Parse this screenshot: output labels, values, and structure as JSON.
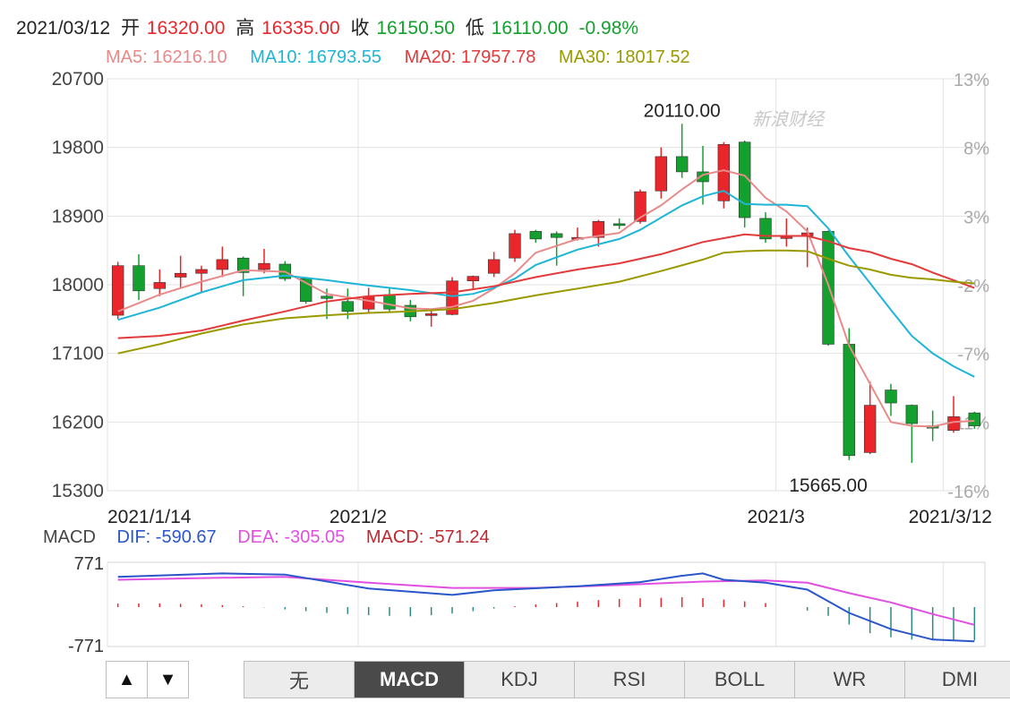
{
  "header": {
    "date": "2021/03/12",
    "open_label": "开",
    "open": "16320.00",
    "high_label": "高",
    "high": "16335.00",
    "close_label": "收",
    "close": "16150.50",
    "low_label": "低",
    "low": "16110.00",
    "change": "-0.98%"
  },
  "ma_legend": [
    {
      "label": "MA5: 16216.10",
      "color": "#e88a8a"
    },
    {
      "label": "MA10: 16793.55",
      "color": "#1fb5d6"
    },
    {
      "label": "MA20: 17957.78",
      "color": "#e23a3a"
    },
    {
      "label": "MA30: 18017.52",
      "color": "#9a9a00"
    }
  ],
  "watermark": "新浪财经",
  "colors": {
    "up": "#e8262b",
    "down": "#14a02e",
    "grid": "#e3e3e3"
  },
  "chart_data": {
    "type": "candlestick",
    "ylim": [
      15300,
      20700
    ],
    "y_ticks": [
      "20700",
      "19800",
      "18900",
      "18000",
      "17100",
      "16200",
      "15300"
    ],
    "pct_ticks": [
      "13%",
      "8%",
      "3%",
      "-2%",
      "-7%",
      "-11%",
      "-16%"
    ],
    "x_labels": [
      {
        "label": "2021/1/14",
        "index": 0
      },
      {
        "label": "2021/2",
        "index": 12
      },
      {
        "label": "2021/3",
        "index": 32
      },
      {
        "label": "2021/3/12",
        "index": 40
      }
    ],
    "annotations": [
      {
        "text": "20110.00",
        "index": 27,
        "value": 20110
      },
      {
        "text": "15665.00",
        "index": 34,
        "value": 15665
      }
    ],
    "candles": [
      {
        "o": 17600,
        "h": 18300,
        "l": 17550,
        "c": 18250
      },
      {
        "o": 18250,
        "h": 18400,
        "l": 17800,
        "c": 17920
      },
      {
        "o": 17950,
        "h": 18200,
        "l": 17850,
        "c": 18030
      },
      {
        "o": 18100,
        "h": 18380,
        "l": 17950,
        "c": 18150
      },
      {
        "o": 18150,
        "h": 18250,
        "l": 17900,
        "c": 18200
      },
      {
        "o": 18200,
        "h": 18500,
        "l": 18100,
        "c": 18330
      },
      {
        "o": 18350,
        "h": 18370,
        "l": 17850,
        "c": 18160
      },
      {
        "o": 18200,
        "h": 18470,
        "l": 18150,
        "c": 18280
      },
      {
        "o": 18270,
        "h": 18310,
        "l": 18050,
        "c": 18080
      },
      {
        "o": 18080,
        "h": 18100,
        "l": 17750,
        "c": 17780
      },
      {
        "o": 17850,
        "h": 17950,
        "l": 17550,
        "c": 17820
      },
      {
        "o": 17780,
        "h": 17950,
        "l": 17550,
        "c": 17650
      },
      {
        "o": 17680,
        "h": 17960,
        "l": 17620,
        "c": 17850
      },
      {
        "o": 17870,
        "h": 17950,
        "l": 17650,
        "c": 17680
      },
      {
        "o": 17730,
        "h": 17800,
        "l": 17520,
        "c": 17580
      },
      {
        "o": 17620,
        "h": 17680,
        "l": 17450,
        "c": 17620
      },
      {
        "o": 17610,
        "h": 18100,
        "l": 17600,
        "c": 18050
      },
      {
        "o": 18050,
        "h": 18120,
        "l": 17950,
        "c": 18110
      },
      {
        "o": 18150,
        "h": 18430,
        "l": 18100,
        "c": 18330
      },
      {
        "o": 18350,
        "h": 18720,
        "l": 18300,
        "c": 18670
      },
      {
        "o": 18700,
        "h": 18720,
        "l": 18550,
        "c": 18600
      },
      {
        "o": 18670,
        "h": 18700,
        "l": 18250,
        "c": 18620
      },
      {
        "o": 18610,
        "h": 18750,
        "l": 18580,
        "c": 18620
      },
      {
        "o": 18620,
        "h": 18850,
        "l": 18500,
        "c": 18830
      },
      {
        "o": 18800,
        "h": 18870,
        "l": 18730,
        "c": 18780
      },
      {
        "o": 18830,
        "h": 19250,
        "l": 18800,
        "c": 19220
      },
      {
        "o": 19230,
        "h": 19800,
        "l": 19130,
        "c": 19680
      },
      {
        "o": 19680,
        "h": 20110,
        "l": 19400,
        "c": 19480
      },
      {
        "o": 19480,
        "h": 19820,
        "l": 19050,
        "c": 19350
      },
      {
        "o": 19100,
        "h": 19870,
        "l": 19000,
        "c": 19840
      },
      {
        "o": 19870,
        "h": 19890,
        "l": 18750,
        "c": 18880
      },
      {
        "o": 18870,
        "h": 18950,
        "l": 18550,
        "c": 18600
      },
      {
        "o": 18610,
        "h": 18870,
        "l": 18500,
        "c": 18630
      },
      {
        "o": 18640,
        "h": 18750,
        "l": 18230,
        "c": 18680
      },
      {
        "o": 18700,
        "h": 18710,
        "l": 17200,
        "c": 17220
      },
      {
        "o": 17220,
        "h": 17430,
        "l": 15700,
        "c": 15760
      },
      {
        "o": 15800,
        "h": 16730,
        "l": 15780,
        "c": 16420
      },
      {
        "o": 16620,
        "h": 16700,
        "l": 16280,
        "c": 16450
      },
      {
        "o": 16420,
        "h": 16430,
        "l": 15665,
        "c": 16180
      },
      {
        "o": 16150,
        "h": 16350,
        "l": 15950,
        "c": 16120
      },
      {
        "o": 16090,
        "h": 16540,
        "l": 16060,
        "c": 16270
      },
      {
        "o": 16320,
        "h": 16335,
        "l": 16110,
        "c": 16150
      }
    ],
    "ma_lines": [
      {
        "name": "MA5",
        "color": "#e88a8a",
        "points": [
          [
            0,
            17650
          ],
          [
            2,
            17870
          ],
          [
            4,
            18040
          ],
          [
            6,
            18190
          ],
          [
            8,
            18170
          ],
          [
            10,
            17880
          ],
          [
            12,
            17790
          ],
          [
            14,
            17690
          ],
          [
            15,
            17680
          ],
          [
            16,
            17710
          ],
          [
            17,
            17790
          ],
          [
            18,
            17950
          ],
          [
            19,
            18150
          ],
          [
            20,
            18420
          ],
          [
            22,
            18600
          ],
          [
            24,
            18680
          ],
          [
            25,
            18880
          ],
          [
            26,
            19040
          ],
          [
            27,
            19250
          ],
          [
            28,
            19440
          ],
          [
            29,
            19500
          ],
          [
            30,
            19430
          ],
          [
            31,
            19140
          ],
          [
            32,
            18960
          ],
          [
            33,
            18700
          ],
          [
            34,
            18000
          ],
          [
            35,
            17200
          ],
          [
            36,
            16700
          ],
          [
            37,
            16200
          ],
          [
            38,
            16150
          ],
          [
            39,
            16140
          ],
          [
            40,
            16200
          ],
          [
            41,
            16216.1
          ]
        ]
      },
      {
        "name": "MA10",
        "color": "#1fb5d6",
        "points": [
          [
            0,
            17540
          ],
          [
            2,
            17700
          ],
          [
            4,
            17900
          ],
          [
            6,
            18060
          ],
          [
            8,
            18120
          ],
          [
            10,
            18060
          ],
          [
            12,
            17990
          ],
          [
            14,
            17930
          ],
          [
            16,
            17850
          ],
          [
            17,
            17880
          ],
          [
            18,
            17960
          ],
          [
            19,
            18080
          ],
          [
            20,
            18260
          ],
          [
            22,
            18460
          ],
          [
            24,
            18600
          ],
          [
            25,
            18720
          ],
          [
            26,
            18880
          ],
          [
            27,
            19040
          ],
          [
            28,
            19160
          ],
          [
            29,
            19230
          ],
          [
            30,
            19060
          ],
          [
            31,
            19050
          ],
          [
            32,
            19050
          ],
          [
            33,
            19030
          ],
          [
            34,
            18740
          ],
          [
            35,
            18370
          ],
          [
            36,
            18020
          ],
          [
            37,
            17670
          ],
          [
            38,
            17330
          ],
          [
            39,
            17100
          ],
          [
            40,
            16930
          ],
          [
            41,
            16793.55
          ]
        ]
      },
      {
        "name": "MA20",
        "color": "#e23a3a",
        "points": [
          [
            0,
            17300
          ],
          [
            2,
            17330
          ],
          [
            4,
            17400
          ],
          [
            6,
            17530
          ],
          [
            8,
            17650
          ],
          [
            10,
            17780
          ],
          [
            12,
            17850
          ],
          [
            14,
            17880
          ],
          [
            16,
            17900
          ],
          [
            18,
            17980
          ],
          [
            20,
            18100
          ],
          [
            22,
            18200
          ],
          [
            24,
            18280
          ],
          [
            26,
            18400
          ],
          [
            28,
            18560
          ],
          [
            29,
            18610
          ],
          [
            30,
            18660
          ],
          [
            31,
            18640
          ],
          [
            32,
            18640
          ],
          [
            33,
            18640
          ],
          [
            34,
            18570
          ],
          [
            35,
            18480
          ],
          [
            36,
            18430
          ],
          [
            37,
            18340
          ],
          [
            38,
            18270
          ],
          [
            39,
            18160
          ],
          [
            40,
            18060
          ],
          [
            41,
            17957.78
          ]
        ]
      },
      {
        "name": "MA30",
        "color": "#9a9a00",
        "points": [
          [
            0,
            17100
          ],
          [
            2,
            17220
          ],
          [
            4,
            17360
          ],
          [
            6,
            17480
          ],
          [
            8,
            17560
          ],
          [
            10,
            17600
          ],
          [
            12,
            17630
          ],
          [
            14,
            17650
          ],
          [
            16,
            17680
          ],
          [
            18,
            17760
          ],
          [
            20,
            17860
          ],
          [
            22,
            17950
          ],
          [
            24,
            18040
          ],
          [
            26,
            18180
          ],
          [
            28,
            18330
          ],
          [
            29,
            18420
          ],
          [
            30,
            18440
          ],
          [
            31,
            18450
          ],
          [
            32,
            18450
          ],
          [
            33,
            18440
          ],
          [
            34,
            18340
          ],
          [
            35,
            18250
          ],
          [
            36,
            18200
          ],
          [
            37,
            18130
          ],
          [
            38,
            18090
          ],
          [
            39,
            18070
          ],
          [
            40,
            18040
          ],
          [
            41,
            18017.52
          ]
        ]
      }
    ]
  },
  "macd": {
    "title": "MACD",
    "dif_label": "DIF: -590.67",
    "dea_label": "DEA: -305.05",
    "macd_label": "MACD: -571.24",
    "dif_color": "#2a56c9",
    "dea_color": "#e14fe0",
    "macd_color": "#c0282d",
    "y_max_label": "771",
    "y_min_label": "-771",
    "ylim": [
      -771,
      771
    ],
    "dif": [
      [
        0,
        520
      ],
      [
        5,
        580
      ],
      [
        8,
        560
      ],
      [
        12,
        320
      ],
      [
        16,
        210
      ],
      [
        18,
        290
      ],
      [
        22,
        360
      ],
      [
        25,
        430
      ],
      [
        27,
        540
      ],
      [
        28,
        580
      ],
      [
        29,
        470
      ],
      [
        31,
        420
      ],
      [
        33,
        300
      ],
      [
        35,
        -100
      ],
      [
        37,
        -380
      ],
      [
        39,
        -560
      ],
      [
        41,
        -590.67
      ]
    ],
    "dea": [
      [
        0,
        470
      ],
      [
        4,
        500
      ],
      [
        8,
        520
      ],
      [
        12,
        420
      ],
      [
        16,
        330
      ],
      [
        20,
        330
      ],
      [
        24,
        380
      ],
      [
        28,
        440
      ],
      [
        31,
        460
      ],
      [
        33,
        420
      ],
      [
        35,
        240
      ],
      [
        37,
        80
      ],
      [
        39,
        -120
      ],
      [
        41,
        -305.05
      ]
    ],
    "hist": [
      60,
      62,
      65,
      55,
      48,
      35,
      15,
      -5,
      -40,
      -70,
      -100,
      -120,
      -140,
      -150,
      -160,
      -140,
      -110,
      -70,
      -25,
      15,
      45,
      70,
      95,
      120,
      140,
      150,
      160,
      170,
      155,
      130,
      100,
      70,
      0,
      -60,
      -150,
      -300,
      -450,
      -520,
      -560,
      -565,
      -570,
      -571.24
    ]
  },
  "tabs": {
    "up_arrow": "▲",
    "down_arrow": "▼",
    "items": [
      {
        "label": "无",
        "name": "tab-none"
      },
      {
        "label": "MACD",
        "name": "tab-macd"
      },
      {
        "label": "KDJ",
        "name": "tab-kdj"
      },
      {
        "label": "RSI",
        "name": "tab-rsi"
      },
      {
        "label": "BOLL",
        "name": "tab-boll"
      },
      {
        "label": "WR",
        "name": "tab-wr"
      },
      {
        "label": "DMI",
        "name": "tab-dmi"
      }
    ],
    "active": "MACD"
  }
}
